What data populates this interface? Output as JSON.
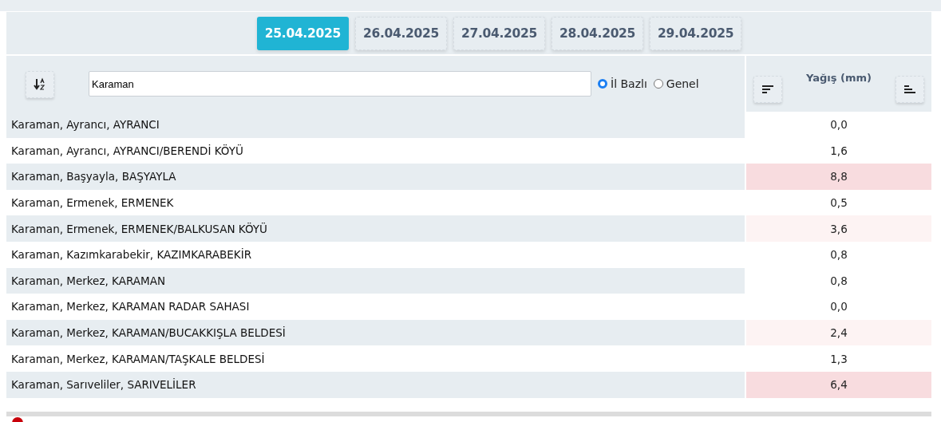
{
  "date_tabs": [
    {
      "label": "25.04.2025",
      "selected": true
    },
    {
      "label": "26.04.2025",
      "selected": false
    },
    {
      "label": "27.04.2025",
      "selected": false
    },
    {
      "label": "28.04.2025",
      "selected": false
    },
    {
      "label": "29.04.2025",
      "selected": false
    }
  ],
  "search": {
    "value": "Karaman"
  },
  "scope_options": [
    {
      "label": "İl Bazlı",
      "selected": true
    },
    {
      "label": "Genel",
      "selected": false
    }
  ],
  "value_column": {
    "title": "Yağış (mm)"
  },
  "rows": [
    {
      "station": "Karaman, Ayrancı, AYRANCI",
      "value": "0,0",
      "color": "#ffffff"
    },
    {
      "station": "Karaman, Ayrancı, AYRANCI/BERENDİ KÖYÜ",
      "value": "1,6",
      "color": "#ffffff"
    },
    {
      "station": "Karaman, Başyayla, BAŞYAYLA",
      "value": "8,8",
      "color": "#f8dcdf"
    },
    {
      "station": "Karaman, Ermenek, ERMENEK",
      "value": "0,5",
      "color": "#ffffff"
    },
    {
      "station": "Karaman, Ermenek, ERMENEK/BALKUSAN KÖYÜ",
      "value": "3,6",
      "color": "#fdf3f3"
    },
    {
      "station": "Karaman, Kazımkarabekir, KAZIMKARABEKİR",
      "value": "0,8",
      "color": "#ffffff"
    },
    {
      "station": "Karaman, Merkez, KARAMAN",
      "value": "0,8",
      "color": "#ffffff"
    },
    {
      "station": "Karaman, Merkez, KARAMAN RADAR SAHASI",
      "value": "0,0",
      "color": "#ffffff"
    },
    {
      "station": "Karaman, Merkez, KARAMAN/BUCAKKIŞLA BELDESİ",
      "value": "2,4",
      "color": "#fdf3f3"
    },
    {
      "station": "Karaman, Merkez, KARAMAN/TAŞKALE BELDESİ",
      "value": "1,3",
      "color": "#ffffff"
    },
    {
      "station": "Karaman, Sarıveliler, SARIVELİLER",
      "value": "6,4",
      "color": "#f8dcdf"
    }
  ]
}
